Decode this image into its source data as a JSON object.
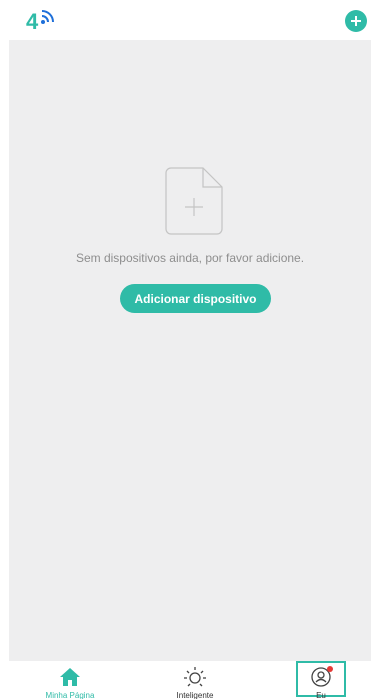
{
  "colors": {
    "accent": "#2fbba7",
    "background": "#eeeeef",
    "text_muted": "#8e8e8e",
    "badge": "#e53935"
  },
  "header": {
    "logo_icon": "app-logo-4g-wifi",
    "add_icon": "plus-circle-icon"
  },
  "empty_state": {
    "icon": "add-file-icon",
    "message": "Sem dispositivos ainda, por favor adicione.",
    "button_label": "Adicionar dispositivo"
  },
  "tabbar": {
    "items": [
      {
        "label": "Minha Página",
        "icon": "home-icon",
        "active": true
      },
      {
        "label": "Inteligente",
        "icon": "sun-icon",
        "active": false
      },
      {
        "label": "Eu",
        "icon": "user-icon",
        "active": false,
        "badge": true
      }
    ]
  }
}
